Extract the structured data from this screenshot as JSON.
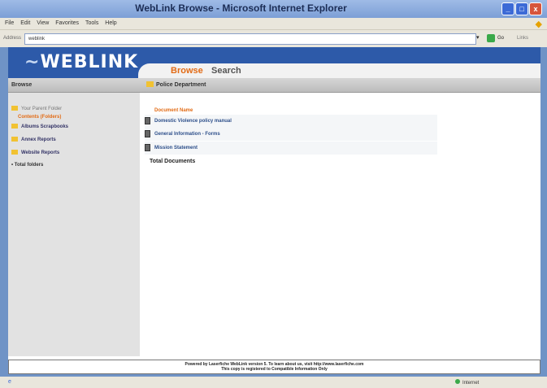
{
  "window": {
    "title": "WebLink Browse - Microsoft Internet Explorer",
    "min_glyph": "_",
    "max_glyph": "□",
    "close_glyph": "x"
  },
  "menubar": {
    "items": [
      "File",
      "Edit",
      "View",
      "Favorites",
      "Tools",
      "Help"
    ]
  },
  "addressbar": {
    "label": "Address",
    "value": "weblink",
    "go_label": "Go",
    "links_label": "Links"
  },
  "banner": {
    "logo_text": "WEBLINK",
    "tabs": {
      "browse": "Browse",
      "search": "Search"
    }
  },
  "navbar": {
    "browse_label": "Browse",
    "breadcrumb": "Police Department"
  },
  "sidebar": {
    "items": [
      "Your Parent Folder",
      "Contents (Folders)",
      "Albums Scrapbooks",
      "Annex Reports",
      "Website Reports",
      "Total folders"
    ]
  },
  "main": {
    "header": "Document Name",
    "documents": [
      "Domestic Violence policy manual",
      "General Information - Forms",
      "Mission Statement"
    ],
    "total_label": "Total Documents"
  },
  "footer": {
    "line1": "Powered by Laserfiche WebLink version 5. To learn about us, visit http://www.laserfiche.com",
    "line2": "This copy is registered to Compatible Information Only"
  },
  "statusbar": {
    "zone": "Internet"
  }
}
